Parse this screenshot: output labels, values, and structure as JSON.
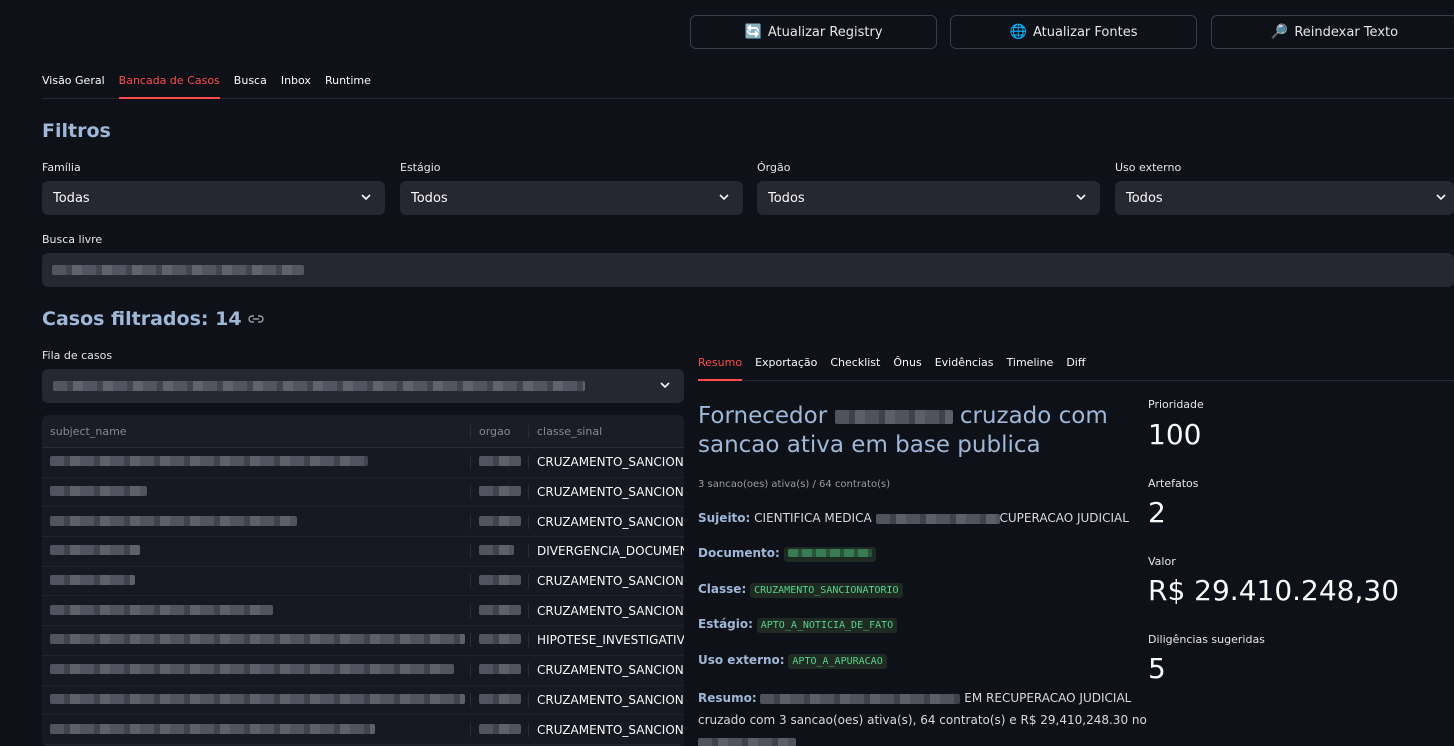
{
  "toolbar": {
    "buttons": [
      {
        "icon": "🔄",
        "label": "Atualizar Registry"
      },
      {
        "icon": "🌐",
        "label": "Atualizar Fontes"
      },
      {
        "icon": "🔎",
        "label": "Reindexar Texto"
      }
    ]
  },
  "nav": {
    "tabs": [
      "Visão Geral",
      "Bancada de Casos",
      "Busca",
      "Inbox",
      "Runtime"
    ],
    "active": "Bancada de Casos"
  },
  "filters": {
    "heading": "Filtros",
    "familia": {
      "label": "Família",
      "value": "Todas"
    },
    "estagio": {
      "label": "Estágio",
      "value": "Todos"
    },
    "orgao": {
      "label": "Órgão",
      "value": "Todos"
    },
    "uso_externo": {
      "label": "Uso externo",
      "value": "Todos"
    },
    "busca_livre": {
      "label": "Busca livre"
    }
  },
  "cases": {
    "heading": "Casos filtrados: 14",
    "queue_label": "Fila de casos",
    "table": {
      "columns": [
        "subject_name",
        "orgao",
        "classe_sinal"
      ],
      "rows": [
        {
          "classe": "CRUZAMENTO_SANCIONATORIO"
        },
        {
          "classe": "CRUZAMENTO_SANCIONATORIO"
        },
        {
          "classe": "CRUZAMENTO_SANCIONATORIO"
        },
        {
          "classe": "DIVERGENCIA_DOCUMENTAL"
        },
        {
          "classe": "CRUZAMENTO_SANCIONATORIO"
        },
        {
          "classe": "CRUZAMENTO_SANCIONATORIO"
        },
        {
          "classe": "HIPOTESE_INVESTIGATIVA"
        },
        {
          "classe": "CRUZAMENTO_SANCIONATORIO"
        },
        {
          "classe": "CRUZAMENTO_SANCIONATORIO"
        },
        {
          "classe": "CRUZAMENTO_SANCIONATORIO"
        }
      ]
    }
  },
  "detail": {
    "tabs": [
      "Resumo",
      "Exportação",
      "Checklist",
      "Ônus",
      "Evidências",
      "Timeline",
      "Diff"
    ],
    "active_tab": "Resumo",
    "title_start": "Fornecedor",
    "title_end": "cruzado com sancao ativa em base publica",
    "caption": "3 sancao(oes) ativa(s) / 64 contrato(s)",
    "sujeito": {
      "label": "Sujeito:",
      "value_start": "CIENTIFICA MEDICA",
      "value_end": "CUPERACAO JUDICIAL"
    },
    "documento": {
      "label": "Documento:"
    },
    "classe": {
      "label": "Classe:",
      "value": "CRUZAMENTO_SANCIONATORIO"
    },
    "estagio": {
      "label": "Estágio:",
      "value": "APTO_A_NOTICIA_DE_FATO"
    },
    "uso_externo": {
      "label": "Uso externo:",
      "value": "APTO_A_APURACAO"
    },
    "resumo": {
      "label": "Resumo:",
      "line1_end": "EM RECUPERACAO JUDICIAL",
      "line2": "cruzado com 3 sancao(oes) ativa(s), 64 contrato(s) e R$ 29,410,248.30 no"
    }
  },
  "metrics": [
    {
      "label": "Prioridade",
      "value": "100"
    },
    {
      "label": "Artefatos",
      "value": "2"
    },
    {
      "label": "Valor",
      "value": "R$ 29.410.248,30"
    },
    {
      "label": "Diligências sugeridas",
      "value": "5"
    }
  ],
  "colors": {
    "accent": "#ff4b4b",
    "heading": "#9fb8d8",
    "code": "#56d38a",
    "bg": "#0e1117"
  }
}
